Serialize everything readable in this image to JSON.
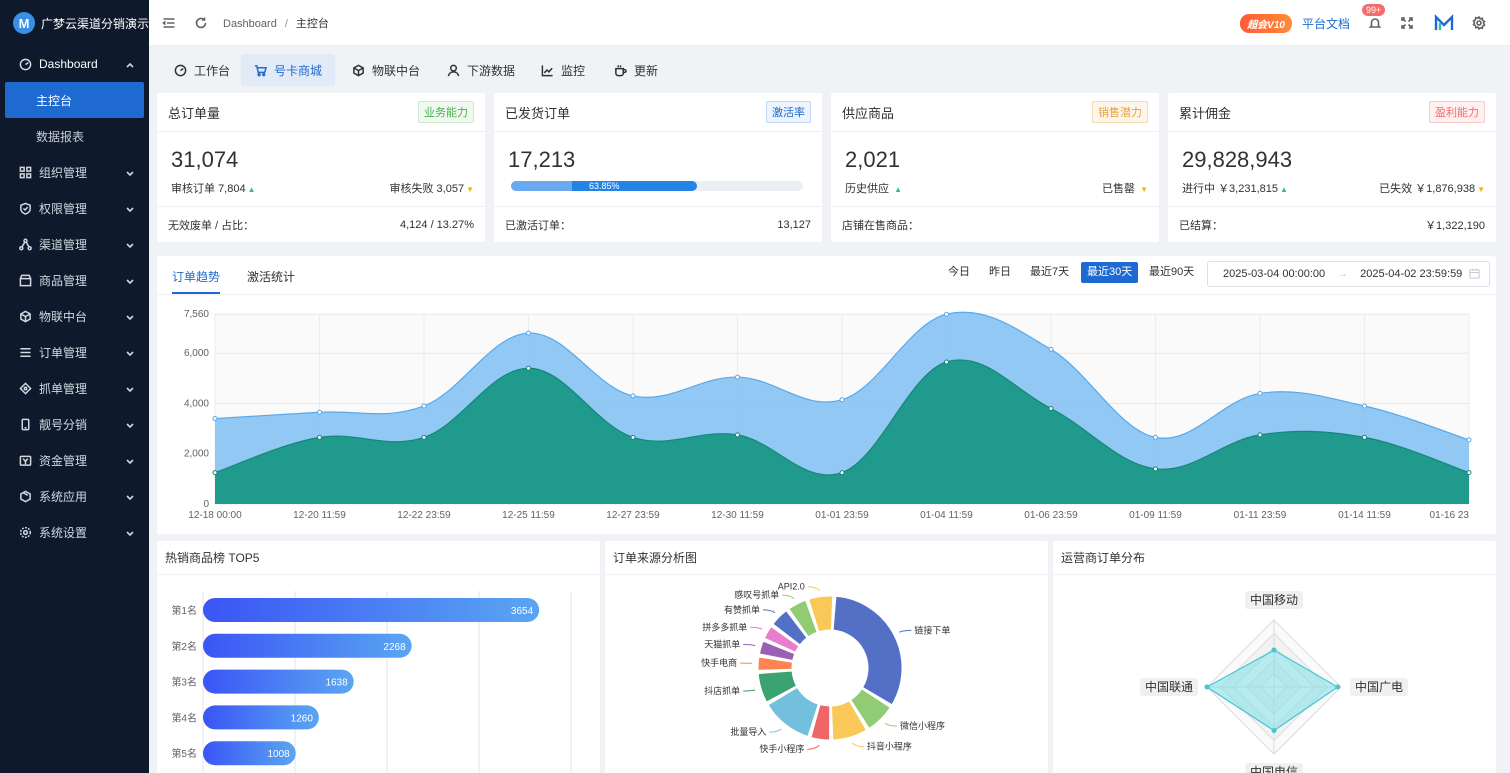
{
  "app": {
    "title": "广梦云渠道分销演示"
  },
  "sidebar": {
    "items": [
      {
        "label": "Dashboard",
        "expanded": true
      },
      {
        "label": "主控台",
        "active": true
      },
      {
        "label": "数据报表"
      },
      {
        "label": "组织管理"
      },
      {
        "label": "权限管理"
      },
      {
        "label": "渠道管理"
      },
      {
        "label": "商品管理"
      },
      {
        "label": "物联中台"
      },
      {
        "label": "订单管理"
      },
      {
        "label": "抓单管理"
      },
      {
        "label": "靓号分销"
      },
      {
        "label": "资金管理"
      },
      {
        "label": "系统应用"
      },
      {
        "label": "系统设置"
      }
    ]
  },
  "header": {
    "breadcrumb": [
      "Dashboard",
      "主控台"
    ],
    "separator": "/",
    "version_badge": "超会V10",
    "doc_link": "平台文档",
    "notifications": "99+"
  },
  "tabs": [
    {
      "label": "工作台"
    },
    {
      "label": "号卡商城",
      "active": true
    },
    {
      "label": "物联中台"
    },
    {
      "label": "下游数据"
    },
    {
      "label": "监控"
    },
    {
      "label": "更新"
    }
  ],
  "stats": [
    {
      "title": "总订单量",
      "tag": "业务能力",
      "value": "31,074",
      "left_label": "审核订单",
      "left_value": "7,804",
      "right_label": "审核失败",
      "right_value": "3,057",
      "foot_label": "无效废单 / 占比：",
      "foot_value": "4,124 / 13.27%"
    },
    {
      "title": "已发货订单",
      "tag": "激活率",
      "value": "17,213",
      "progress": 0.6385,
      "progress_label": "63.85%",
      "foot_label": "已激活订单：",
      "foot_value": "13,127"
    },
    {
      "title": "供应商品",
      "tag": "销售潜力",
      "value": "2,021",
      "left_label": "历史供应",
      "left_value": "",
      "right_label": "已售罄",
      "right_value": "",
      "foot_label": "店铺在售商品：",
      "foot_value": ""
    },
    {
      "title": "累计佣金",
      "tag": "盈利能力",
      "value": "29,828,943",
      "left_label": "进行中",
      "left_value": "￥3,231,815",
      "right_label": "已失效",
      "right_value": "￥1,876,938",
      "foot_label": "已结算：",
      "foot_value": "￥1,322,190"
    }
  ],
  "trend": {
    "tabs": [
      "订单趋势",
      "激活统计"
    ],
    "ranges": [
      "今日",
      "昨日",
      "最近7天",
      "最近30天",
      "最近90天"
    ],
    "active_range": "最近30天",
    "date_start": "2025-03-04 00:00:00",
    "date_end": "2025-04-02 23:59:59"
  },
  "chart_data": [
    {
      "type": "area",
      "x": [
        "12-18 00:00",
        "12-20 11:59",
        "12-22 23:59",
        "12-25 11:59",
        "12-27 23:59",
        "12-30 11:59",
        "01-01 23:59",
        "01-04 11:59",
        "01-06 23:59",
        "01-09 11:59",
        "01-11 23:59",
        "01-14 11:59",
        "01-16 23"
      ],
      "ylim": [
        0,
        7560
      ],
      "yticks": [
        "0",
        "2,000",
        "4,000",
        "6,000",
        "7,560"
      ],
      "series": [
        {
          "values": [
            3400,
            3650,
            3900,
            6800,
            4300,
            5050,
            4150,
            7550,
            6150,
            2650,
            4400,
            3900,
            2550
          ],
          "color": "#8cc5f3"
        },
        {
          "values": [
            1250,
            2650,
            2650,
            5400,
            2650,
            2750,
            1250,
            5650,
            3800,
            1400,
            2750,
            2650,
            1250
          ],
          "color": "#1f9a8c"
        }
      ]
    },
    {
      "type": "bar",
      "title": "热销商品榜 TOP5",
      "categories": [
        "第1名",
        "第2名",
        "第3名",
        "第4名",
        "第5名"
      ],
      "values": [
        3654,
        2268,
        1638,
        1260,
        1008
      ]
    },
    {
      "type": "pie",
      "title": "订单来源分析图",
      "labels": [
        "链接下单",
        "微信小程序",
        "抖音小程序",
        "快手小程序",
        "批量导入",
        "抖店抓单",
        "快手电商",
        "天猫抓单",
        "拼多多抓单",
        "有赞抓单",
        "感叹号抓单",
        "API2.0"
      ],
      "values": [
        27,
        6,
        7,
        4,
        10,
        6,
        3,
        3,
        3,
        4,
        4,
        5
      ],
      "colors": [
        "#5470c6",
        "#91cc75",
        "#fac858",
        "#ee6666",
        "#73c0de",
        "#3ba272",
        "#fc8452",
        "#9a60b4",
        "#ea7ccc",
        "#5470c6",
        "#91cc75",
        "#fac858"
      ]
    },
    {
      "type": "radar",
      "title": "运营商订单分布",
      "indicators": [
        "中国移动",
        "中国广电",
        "中国电信",
        "中国联通"
      ],
      "values": [
        0.55,
        0.95,
        0.65,
        1.0
      ]
    }
  ]
}
